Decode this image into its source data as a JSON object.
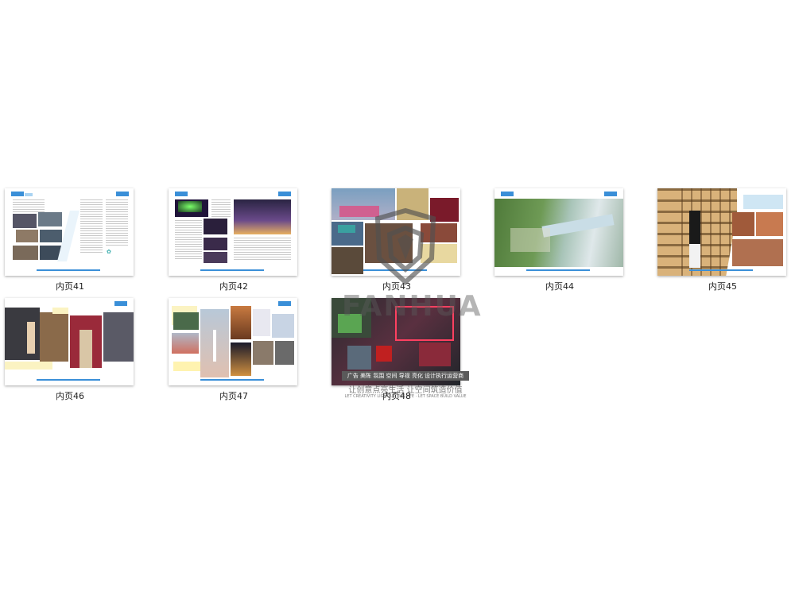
{
  "pages": [
    {
      "label": "内页41"
    },
    {
      "label": "内页42"
    },
    {
      "label": "内页43"
    },
    {
      "label": "内页44"
    },
    {
      "label": "内页45"
    },
    {
      "label": "内页46"
    },
    {
      "label": "内页47"
    },
    {
      "label": "内页48"
    }
  ],
  "page_thumbs": {
    "p41": {
      "caption": "内页41"
    },
    "p42": {
      "caption": "内页42"
    },
    "p43": {
      "caption": "内页43"
    },
    "p44": {
      "caption": "内页44"
    },
    "p45": {
      "caption": "内页45"
    },
    "p46": {
      "caption": "内页46"
    },
    "p47": {
      "caption": "内页47"
    },
    "p48": {
      "caption": "内页48"
    }
  },
  "watermark": {
    "brand": "FANHUA",
    "tagline": "广告 美陈 氛围 空间 导视 亮化 设计执行运营商",
    "slogan": "让创意点亮生活 让空间筑造价值",
    "slogan_en": "LET CREATIVITY LIGHT UP THE LIFE · LET SPACE BUILD VALUE"
  },
  "colors": {
    "accent": "#3a8fd8",
    "background": "#ffffff"
  }
}
